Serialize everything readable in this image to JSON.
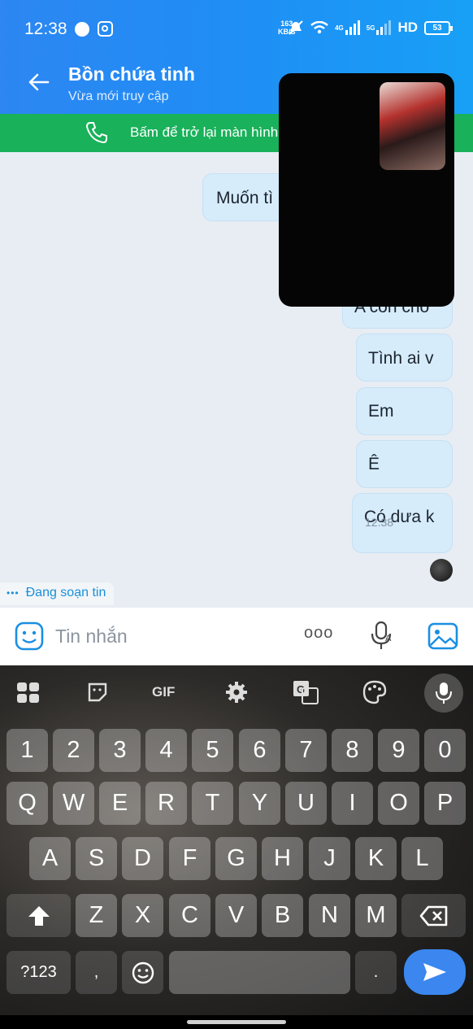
{
  "status_bar": {
    "time": "12:38",
    "net_speed_value": "163",
    "net_speed_unit": "KB/S",
    "sim1_label": "4G",
    "sim2_label": "5G",
    "hd_label": "HD",
    "battery": "53"
  },
  "header": {
    "title": "Bồn chứa tinh",
    "subtitle": "Vừa mới truy cập"
  },
  "call_banner": {
    "text": "Bấm để trở lại màn hình"
  },
  "messages": [
    {
      "text": "Muốn tì"
    },
    {
      "text": "A còn chờ"
    },
    {
      "text": "Tình ai v"
    },
    {
      "text": "Em"
    },
    {
      "text": "Ê"
    },
    {
      "text": "Có dưa k",
      "time": "12:38"
    }
  ],
  "typing_indicator": {
    "dots": "•••",
    "text": "Đang soạn tin"
  },
  "input": {
    "placeholder": "Tin nhắn",
    "more_label": "ooo"
  },
  "keyboard": {
    "toolbar": {
      "gif_label": "GIF"
    },
    "number_row": [
      "1",
      "2",
      "3",
      "4",
      "5",
      "6",
      "7",
      "8",
      "9",
      "0"
    ],
    "row1": [
      "Q",
      "W",
      "E",
      "R",
      "T",
      "Y",
      "U",
      "I",
      "O",
      "P"
    ],
    "row2": [
      "A",
      "S",
      "D",
      "F",
      "G",
      "H",
      "J",
      "K",
      "L"
    ],
    "row3": [
      "Z",
      "X",
      "C",
      "V",
      "B",
      "N",
      "M"
    ],
    "symbols_label": "?123",
    "comma": ",",
    "period": "."
  },
  "colors": {
    "header_blue": "#2d86f2",
    "call_banner_green": "#19b15a",
    "bubble_blue": "#d6ecfb",
    "send_blue": "#3b87ef"
  }
}
